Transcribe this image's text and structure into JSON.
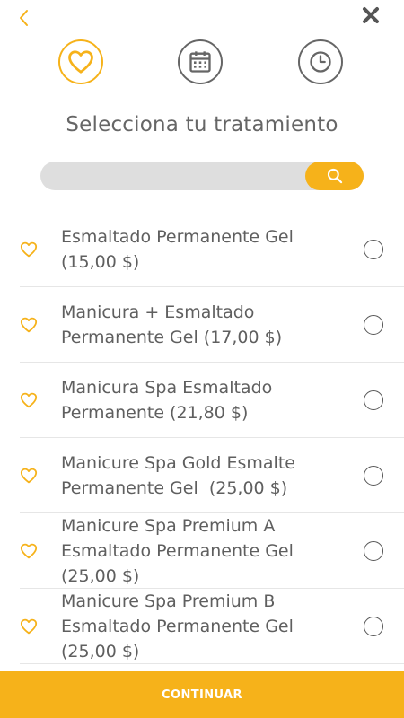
{
  "header": {
    "back_icon": "chevron-left-icon",
    "close_icon": "close-icon"
  },
  "steps": [
    {
      "icon": "heart-icon",
      "active": true
    },
    {
      "icon": "calendar-icon",
      "active": false
    },
    {
      "icon": "clock-icon",
      "active": false
    }
  ],
  "page_title": "Selecciona tu tratamiento",
  "search": {
    "value": "",
    "placeholder": "",
    "icon": "search-icon"
  },
  "treatments": [
    {
      "label": "Esmaltado Permanente Gel\n(15,00 $)"
    },
    {
      "label": "Manicura + Esmaltado\nPermanente Gel (17,00 $)"
    },
    {
      "label": "Manicura Spa Esmaltado\nPermanente (21,80 $)"
    },
    {
      "label": "Manicure Spa Gold Esmalte\nPermanente Gel  (25,00 $)"
    },
    {
      "label": "Manicure Spa Premium A\nEsmaltado Permanente Gel\n(25,00 $)"
    },
    {
      "label": "Manicure Spa Premium B\nEsmaltado Permanente Gel\n(25,00 $)"
    }
  ],
  "continue_label": "CONTINUAR",
  "colors": {
    "accent": "#f6b21a",
    "text": "#5f5f5f",
    "search_bg": "#dedede"
  }
}
